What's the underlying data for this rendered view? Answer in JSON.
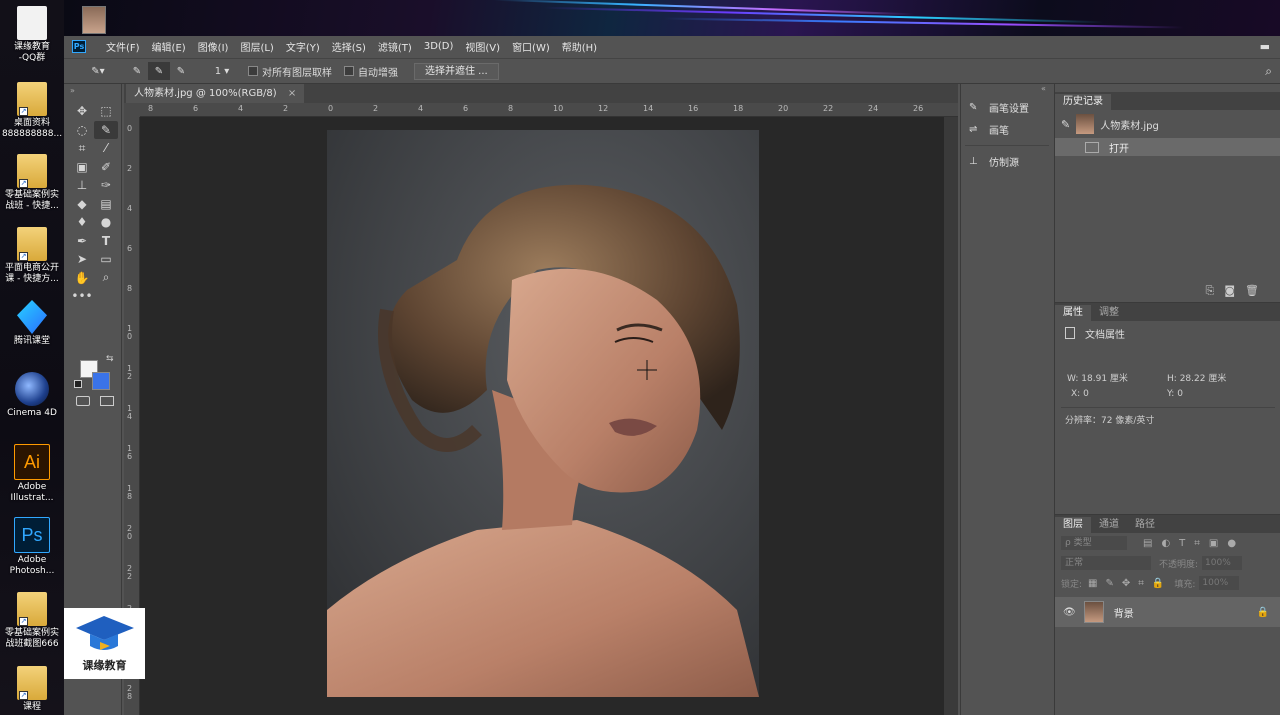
{
  "desktop": {
    "icons": [
      {
        "label": "课缘教育\n-QQ群",
        "icon": "document-icon"
      },
      {
        "label": "桌面资料\n888888888...",
        "icon": "folder-icon"
      },
      {
        "label": "零基础案例实\n战班 - 快捷...",
        "icon": "folder-icon"
      },
      {
        "label": "平面电商公开\n课 - 快捷方...",
        "icon": "folder-icon"
      },
      {
        "label": "腾讯课堂",
        "icon": "tencent-classroom-icon"
      },
      {
        "label": "Cinema 4D",
        "icon": "cinema4d-icon"
      },
      {
        "label": "Adobe\nIllustrat...",
        "icon": "illustrator-icon",
        "glyph": "Ai"
      },
      {
        "label": "Adobe\nPhotosh...",
        "icon": "photoshop-icon",
        "glyph": "Ps"
      },
      {
        "label": "零基础案例实\n战班截图666",
        "icon": "folder-icon"
      },
      {
        "label": "课程",
        "icon": "folder-icon"
      }
    ],
    "watermark_text": "课缘教育"
  },
  "app": {
    "logo": "Ps",
    "menu": [
      "文件(F)",
      "编辑(E)",
      "图像(I)",
      "图层(L)",
      "文字(Y)",
      "选择(S)",
      "滤镜(T)",
      "3D(D)",
      "视图(V)",
      "窗口(W)",
      "帮助(H)"
    ]
  },
  "options": {
    "brush_size": "1",
    "sample_all_layers": "对所有图层取样",
    "auto_enhance": "自动增强",
    "select_mask": "选择并遮住 ..."
  },
  "document": {
    "tab_title": "人物素材.jpg @ 100%(RGB/8)",
    "close_glyph": "×",
    "ruler_h": [
      "8",
      "6",
      "4",
      "2",
      "0",
      "2",
      "4",
      "6",
      "8",
      "10",
      "12",
      "14",
      "16",
      "18",
      "20",
      "22",
      "24",
      "26"
    ],
    "ruler_v": [
      "0",
      "2",
      "4",
      "6",
      "8",
      "1 0",
      "1 2",
      "1 4",
      "1 6",
      "1 8",
      "2 0",
      "2 2",
      "2 4",
      "2 6",
      "2 8"
    ]
  },
  "panel_a": {
    "items": [
      {
        "label": "画笔设置",
        "icon": "brush-settings-icon"
      },
      {
        "label": "画笔",
        "icon": "brush-icon"
      },
      {
        "label": "仿制源",
        "icon": "clone-source-icon"
      }
    ]
  },
  "history": {
    "tab": "历史记录",
    "snapshot": "人物素材.jpg",
    "steps": [
      "打开"
    ]
  },
  "properties": {
    "tabs": [
      "属性",
      "调整"
    ],
    "title": "文档属性",
    "w_label": "W:",
    "w_value": "18.91 厘米",
    "h_label": "H:",
    "h_value": "28.22 厘米",
    "x_label": "X:",
    "x_value": "0",
    "y_label": "Y:",
    "y_value": "0",
    "resolution": "分辨率：72 像素/英寸"
  },
  "layers": {
    "tabs": [
      "图层",
      "通道",
      "路径"
    ],
    "filter_placeholder": "ρ 类型",
    "blend_mode": "正常",
    "opacity_label": "不透明度:",
    "opacity_value": "100%",
    "lock_label": "锁定:",
    "fill_label": "填充:",
    "fill_value": "100%",
    "items": [
      {
        "name": "背景",
        "locked": true
      }
    ]
  },
  "colors": {
    "accent": "#31a8ff",
    "bg_swatch": "#3a73e8",
    "fg_swatch": "#f4f4f4"
  }
}
